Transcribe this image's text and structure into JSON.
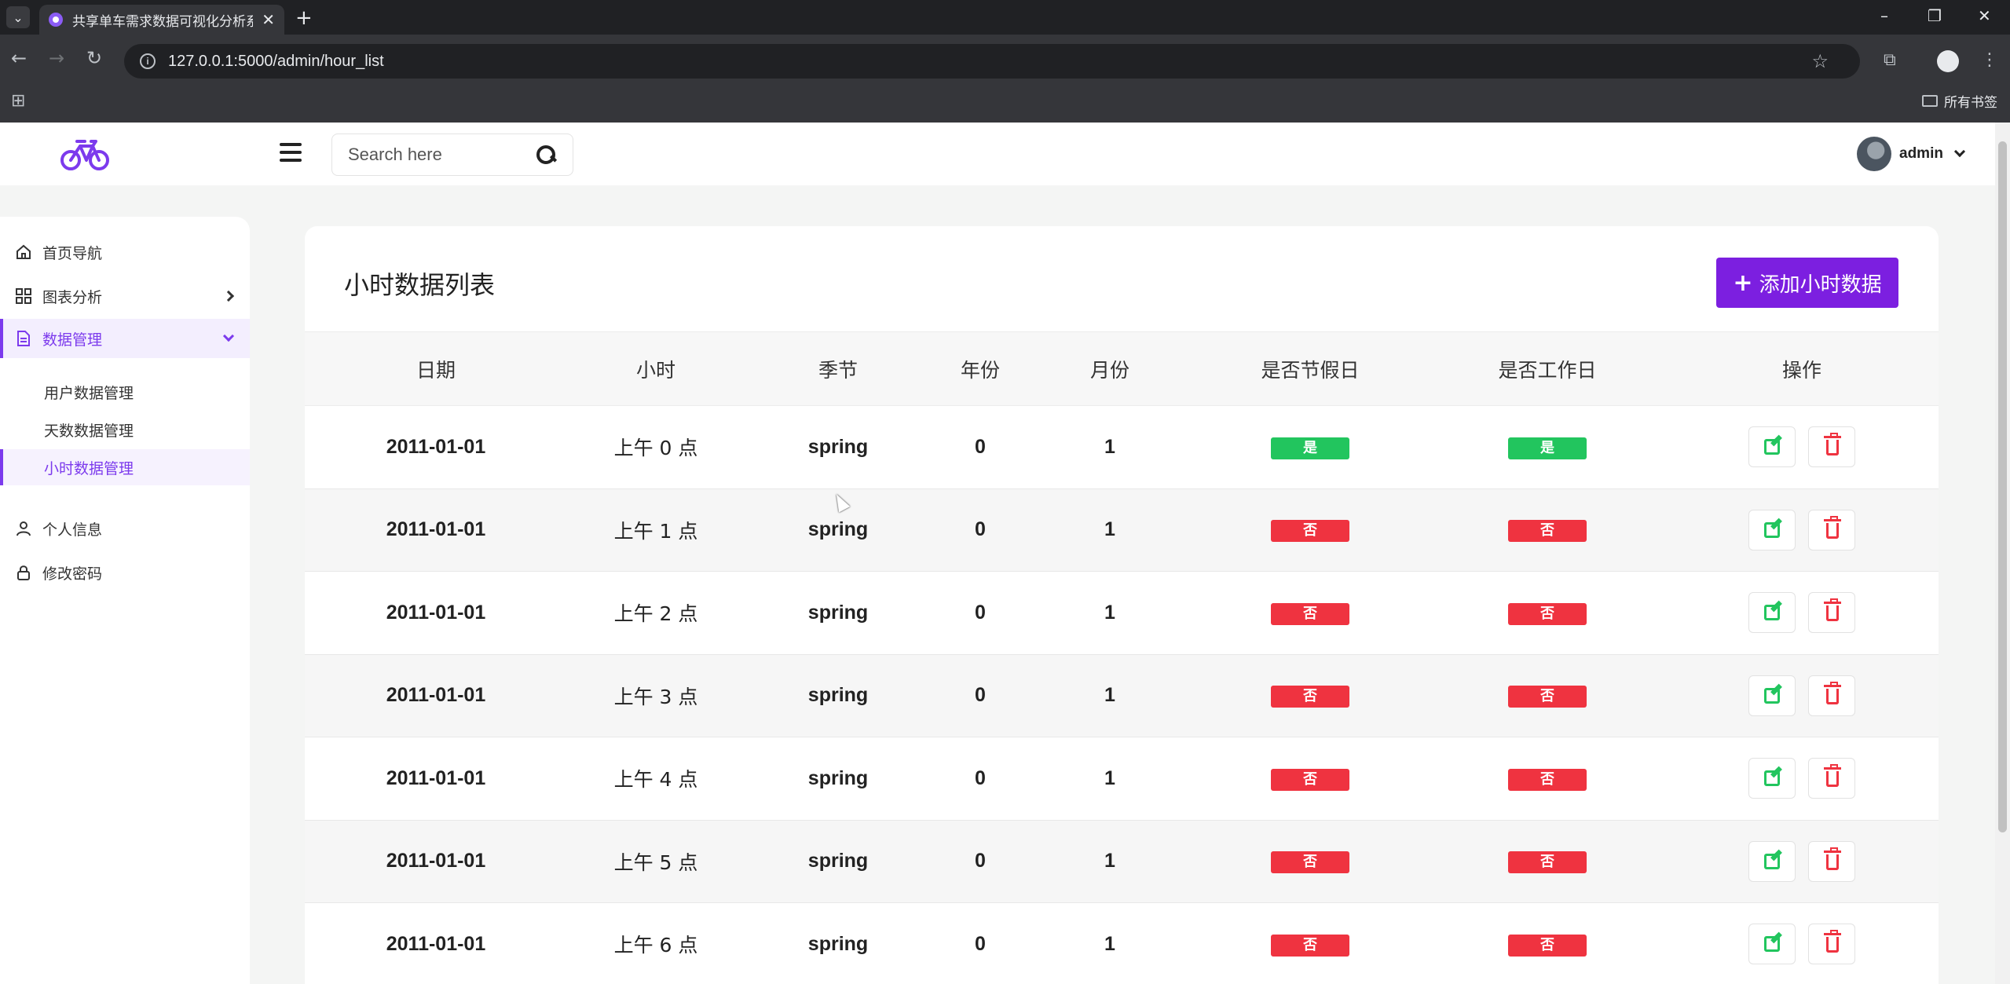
{
  "browser": {
    "tab_title": "共享单车需求数据可视化分析系",
    "url": "127.0.0.1:5000/admin/hour_list",
    "bookmarks_label": "所有书签"
  },
  "header": {
    "search_placeholder": "Search here",
    "user_name": "admin"
  },
  "sidebar": {
    "items": [
      {
        "label": "首页导航",
        "icon": "home-icon"
      },
      {
        "label": "图表分析",
        "icon": "grid-icon"
      },
      {
        "label": "数据管理",
        "icon": "document-icon"
      },
      {
        "label": "个人信息",
        "icon": "user-icon"
      },
      {
        "label": "修改密码",
        "icon": "lock-icon"
      }
    ],
    "sub_items": [
      {
        "label": "用户数据管理"
      },
      {
        "label": "天数数据管理"
      },
      {
        "label": "小时数据管理"
      }
    ]
  },
  "main": {
    "title": "小时数据列表",
    "add_button": "添加小时数据",
    "columns": [
      "日期",
      "小时",
      "季节",
      "年份",
      "月份",
      "是否节假日",
      "是否工作日",
      "操作"
    ],
    "rows": [
      {
        "date": "2011-01-01",
        "hour": "上午 0 点",
        "season": "spring",
        "year": "0",
        "month": "1",
        "holiday": "是",
        "workday": "是"
      },
      {
        "date": "2011-01-01",
        "hour": "上午 1 点",
        "season": "spring",
        "year": "0",
        "month": "1",
        "holiday": "否",
        "workday": "否"
      },
      {
        "date": "2011-01-01",
        "hour": "上午 2 点",
        "season": "spring",
        "year": "0",
        "month": "1",
        "holiday": "否",
        "workday": "否"
      },
      {
        "date": "2011-01-01",
        "hour": "上午 3 点",
        "season": "spring",
        "year": "0",
        "month": "1",
        "holiday": "否",
        "workday": "否"
      },
      {
        "date": "2011-01-01",
        "hour": "上午 4 点",
        "season": "spring",
        "year": "0",
        "month": "1",
        "holiday": "否",
        "workday": "否"
      },
      {
        "date": "2011-01-01",
        "hour": "上午 5 点",
        "season": "spring",
        "year": "0",
        "month": "1",
        "holiday": "否",
        "workday": "否"
      },
      {
        "date": "2011-01-01",
        "hour": "上午 6 点",
        "season": "spring",
        "year": "0",
        "month": "1",
        "holiday": "否",
        "workday": "否"
      }
    ]
  },
  "colors": {
    "accent": "#7c1fe0",
    "yes_badge": "#22c55e",
    "no_badge": "#ef3340"
  }
}
